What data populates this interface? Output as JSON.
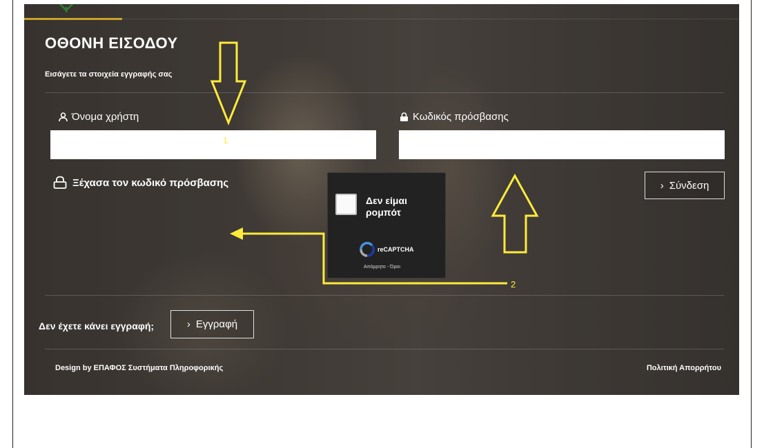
{
  "page": {
    "title": "ΟΘΟΝΗ ΕΙΣΟΔΟΥ",
    "subtitle": "Εισάγετε τα στοιχεία εγγραφής σας"
  },
  "login": {
    "username_label": "Όνομα χρήστη",
    "username_value": "",
    "password_label": "Κωδικός πρόσβασης",
    "password_value": "",
    "forgot_password": "Ξέχασα τον κωδικό πρόσβασης",
    "submit_label": "Σύνδεση"
  },
  "recaptcha": {
    "label": "Δεν είμαι ρομπότ",
    "brand": "reCAPTCHA",
    "terms": "Απόρρητο - Όροι"
  },
  "register": {
    "prompt": "Δεν έχετε κάνει εγγραφή;",
    "button_label": "Εγγραφή"
  },
  "footer": {
    "credit": "Design by ΕΠΑΦΟΣ Συστήματα Πληροφορικής",
    "privacy": "Πολιτική Απορρήτου"
  },
  "annotations": {
    "marker_1": "1",
    "marker_2": "2",
    "color": "#ffeb3b"
  },
  "colors": {
    "accent": "#c9a227",
    "background_overlay": "#3f3a36"
  },
  "icons": [
    "logo-icon",
    "user-icon",
    "lock-icon",
    "chevron-right-icon",
    "recaptcha-icon"
  ]
}
